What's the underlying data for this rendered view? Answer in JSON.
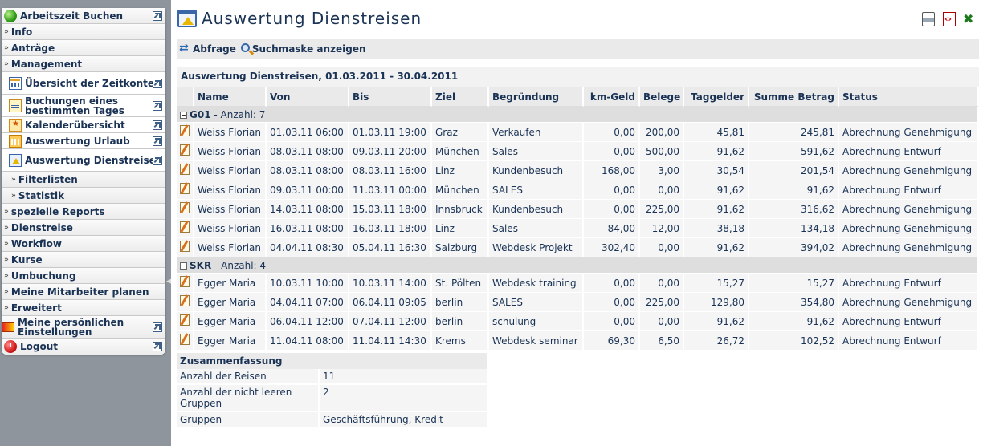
{
  "sidebar": {
    "items": [
      {
        "label": "Arbeitszeit Buchen",
        "icon": "green-circle-icon"
      },
      {
        "label": "Info"
      },
      {
        "label": "Anträge"
      },
      {
        "label": "Management"
      },
      {
        "label": "Übersicht der Zeitkonten",
        "icon": "grid-icon"
      },
      {
        "label": "Buchungen eines bestimmten Tages",
        "icon": "list-icon"
      },
      {
        "label": "Kalenderübersicht",
        "icon": "calendar-icon"
      },
      {
        "label": "Auswertung Urlaub",
        "icon": "holiday-calendar-icon"
      },
      {
        "label": "Auswertung Dienstreisen",
        "icon": "business-trip-icon"
      },
      {
        "label": "Filterlisten"
      },
      {
        "label": "Statistik"
      },
      {
        "label": "spezielle Reports"
      },
      {
        "label": "Dienstreise"
      },
      {
        "label": "Workflow"
      },
      {
        "label": "Kurse"
      },
      {
        "label": "Umbuchung"
      },
      {
        "label": "Meine Mitarbeiter planen"
      },
      {
        "label": "Erweitert"
      },
      {
        "label": "Meine persönlichen Einstellungen",
        "icon": "settings-gradient-icon"
      },
      {
        "label": "Logout",
        "icon": "logout-icon"
      }
    ]
  },
  "header": {
    "title": "Auswertung Dienstreisen"
  },
  "toolbar": {
    "abfrage_label": "Abfrage",
    "suchmaske_label": "Suchmaske anzeigen"
  },
  "report": {
    "title": "Auswertung Dienstreisen, 01.03.2011 - 30.04.2011",
    "columns": [
      "Name",
      "Von",
      "Bis",
      "Ziel",
      "Begründung",
      "km-Geld",
      "Belege",
      "Taggelder",
      "Summe Betrag",
      "Status"
    ],
    "groups": [
      {
        "name": "G01",
        "count_label": " - Anzahl: 7",
        "rows": [
          [
            "Weiss Florian",
            "01.03.11 06:00",
            "01.03.11 19:00",
            "Graz",
            "Verkaufen",
            "0,00",
            "200,00",
            "45,81",
            "245,81",
            "Abrechnung Genehmigung"
          ],
          [
            "Weiss Florian",
            "08.03.11 08:00",
            "09.03.11 20:00",
            "München",
            "Sales",
            "0,00",
            "500,00",
            "91,62",
            "591,62",
            "Abrechnung Entwurf"
          ],
          [
            "Weiss Florian",
            "08.03.11 08:00",
            "08.03.11 16:00",
            "Linz",
            "Kundenbesuch",
            "168,00",
            "3,00",
            "30,54",
            "201,54",
            "Abrechnung Genehmigung"
          ],
          [
            "Weiss Florian",
            "09.03.11 00:00",
            "11.03.11 00:00",
            "München",
            "SALES",
            "0,00",
            "0,00",
            "91,62",
            "91,62",
            "Abrechnung Entwurf"
          ],
          [
            "Weiss Florian",
            "14.03.11 08:00",
            "15.03.11 18:00",
            "Innsbruck",
            "Kundenbesuch",
            "0,00",
            "225,00",
            "91,62",
            "316,62",
            "Abrechnung Genehmigung"
          ],
          [
            "Weiss Florian",
            "16.03.11 08:00",
            "16.03.11 18:00",
            "Linz",
            "Sales",
            "84,00",
            "12,00",
            "38,18",
            "134,18",
            "Abrechnung Genehmigung"
          ],
          [
            "Weiss Florian",
            "04.04.11 08:30",
            "05.04.11 16:30",
            "Salzburg",
            "Webdesk Projekt",
            "302,40",
            "0,00",
            "91,62",
            "394,02",
            "Abrechnung Genehmigung"
          ]
        ]
      },
      {
        "name": "SKR",
        "count_label": " - Anzahl: 4",
        "rows": [
          [
            "Egger Maria",
            "10.03.11 10:00",
            "10.03.11 14:00",
            "St. Pölten",
            "Webdesk training",
            "0,00",
            "0,00",
            "15,27",
            "15,27",
            "Abrechnung Entwurf"
          ],
          [
            "Egger Maria",
            "04.04.11 07:00",
            "06.04.11 09:05",
            "berlin",
            "SALES",
            "0,00",
            "225,00",
            "129,80",
            "354,80",
            "Abrechnung Genehmigung"
          ],
          [
            "Egger Maria",
            "06.04.11 12:00",
            "07.04.11 12:00",
            "berlin",
            "schulung",
            "0,00",
            "0,00",
            "91,62",
            "91,62",
            "Abrechnung Entwurf"
          ],
          [
            "Egger Maria",
            "11.04.11 08:00",
            "11.04.11 14:30",
            "Krems",
            "Webdesk seminar",
            "69,30",
            "6,50",
            "26,72",
            "102,52",
            "Abrechnung Entwurf"
          ]
        ]
      }
    ]
  },
  "summary": {
    "title": "Zusammenfassung",
    "rows": [
      {
        "label": "Anzahl der Reisen",
        "value": "11"
      },
      {
        "label": "Anzahl der nicht leeren Gruppen",
        "value": "2"
      },
      {
        "label": "Gruppen",
        "value": "Geschäftsführung, Kredit"
      }
    ]
  },
  "colors": {
    "text": "#1a3355",
    "sidebar_bg": "#8e959c",
    "header_row": "#eaeaea",
    "group_row": "#dedede"
  }
}
